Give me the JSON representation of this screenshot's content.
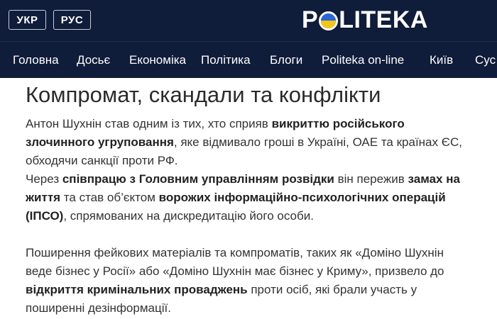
{
  "header": {
    "lang_ukr": "УКР",
    "lang_rus": "РУС",
    "logo": {
      "before": "P",
      "after": "LITEKA",
      "icon": "ukraine-flag-circle"
    }
  },
  "nav": {
    "items": [
      {
        "label": "Головна"
      },
      {
        "label": "Досьє"
      },
      {
        "label": "Економіка"
      },
      {
        "label": "Політика"
      },
      {
        "label": "Блоги"
      },
      {
        "label": "Politeka on-line"
      },
      {
        "label": "Київ"
      },
      {
        "label": "Сус"
      }
    ]
  },
  "article": {
    "title": "Компромат, скандали та конфлікти",
    "paragraphs": [
      {
        "s1": "Антон Шухнін став одним із тих, хто сприяв ",
        "b1": "викриттю російського злочинного угруповання",
        "s2": ", яке відмивало гроші в Україні, ОАЕ та країнах ЄС, обходячи санкції проти РФ."
      },
      {
        "s1": "Через ",
        "b1": "співпрацю з Головним управлінням розвідки",
        "s2": " він пережив ",
        "b2": "замах на життя",
        "s3": " та став об’єктом ",
        "b3": "ворожих інформаційно-психологічних операцій (ІПСО)",
        "s4": ", спрямованих на дискредитацію його особи."
      },
      {
        "s1": "Поширення фейкових матеріалів та компроматів, таких як «Доміно Шухнін веде бізнес у Росії» або «Доміно Шухнін має бізнес у Криму», призвело до ",
        "b1": "відкриття кримінальних проваджень",
        "s2": " проти осіб, які брали участь у поширенні дезінформації."
      }
    ]
  },
  "colors": {
    "header_bg": "#0f1c3a",
    "logo_blue": "#2a66d6",
    "logo_yellow": "#f5c518"
  }
}
